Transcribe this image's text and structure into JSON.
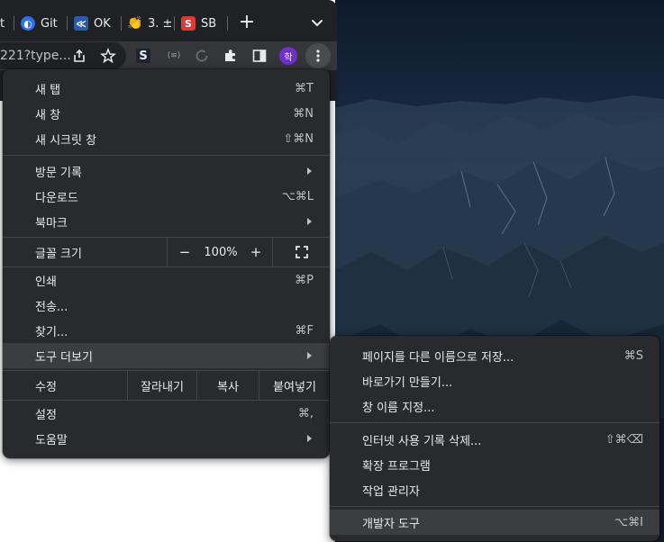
{
  "tabs": [
    {
      "label": "t",
      "favicon": "page-fragment"
    },
    {
      "label": "Git",
      "favicon": "github-icon"
    },
    {
      "label": "OK",
      "favicon": "okjsp-icon"
    },
    {
      "label": "3. ±",
      "favicon": "hand-icon"
    },
    {
      "label": "SB",
      "favicon": "sb-icon"
    }
  ],
  "tabstrip": {
    "new_tab": "+"
  },
  "toolbar": {
    "url_fragment": "221?type...",
    "extension_s": "S",
    "extension_mid": "(≋)",
    "profile_initial": "학"
  },
  "main_menu": {
    "new_tab": {
      "label": "새 탭",
      "shortcut": "⌘T"
    },
    "new_window": {
      "label": "새 창",
      "shortcut": "⌘N"
    },
    "new_incognito": {
      "label": "새 시크릿 창",
      "shortcut": "⇧⌘N"
    },
    "history": {
      "label": "방문 기록"
    },
    "downloads": {
      "label": "다운로드",
      "shortcut": "⌥⌘L"
    },
    "bookmarks": {
      "label": "북마크"
    },
    "zoom": {
      "label": "글꼴 크기",
      "minus": "−",
      "value": "100%",
      "plus": "+"
    },
    "print": {
      "label": "인쇄",
      "shortcut": "⌘P"
    },
    "cast": {
      "label": "전송..."
    },
    "find": {
      "label": "찾기...",
      "shortcut": "⌘F"
    },
    "more_tools": {
      "label": "도구 더보기"
    },
    "edit": {
      "label": "수정",
      "cut": "잘라내기",
      "copy": "복사",
      "paste": "붙여넣기"
    },
    "settings": {
      "label": "설정",
      "shortcut": "⌘,"
    },
    "help": {
      "label": "도움말"
    }
  },
  "sub_menu": {
    "save_page": {
      "label": "페이지를 다른 이름으로 저장...",
      "shortcut": "⌘S"
    },
    "create_shortcut": {
      "label": "바로가기 만들기..."
    },
    "name_window": {
      "label": "창 이름 지정..."
    },
    "clear_data": {
      "label": "인터넷 사용 기록 삭제...",
      "shortcut": "⇧⌘⌫"
    },
    "extensions": {
      "label": "확장 프로그램"
    },
    "task_manager": {
      "label": "작업 관리자"
    },
    "dev_tools": {
      "label": "개발자 도구",
      "shortcut": "⌥⌘I"
    }
  },
  "colors": {
    "menu_bg": "#292a2d",
    "hover": "#3c3d41",
    "profile": "#6f30c9"
  }
}
